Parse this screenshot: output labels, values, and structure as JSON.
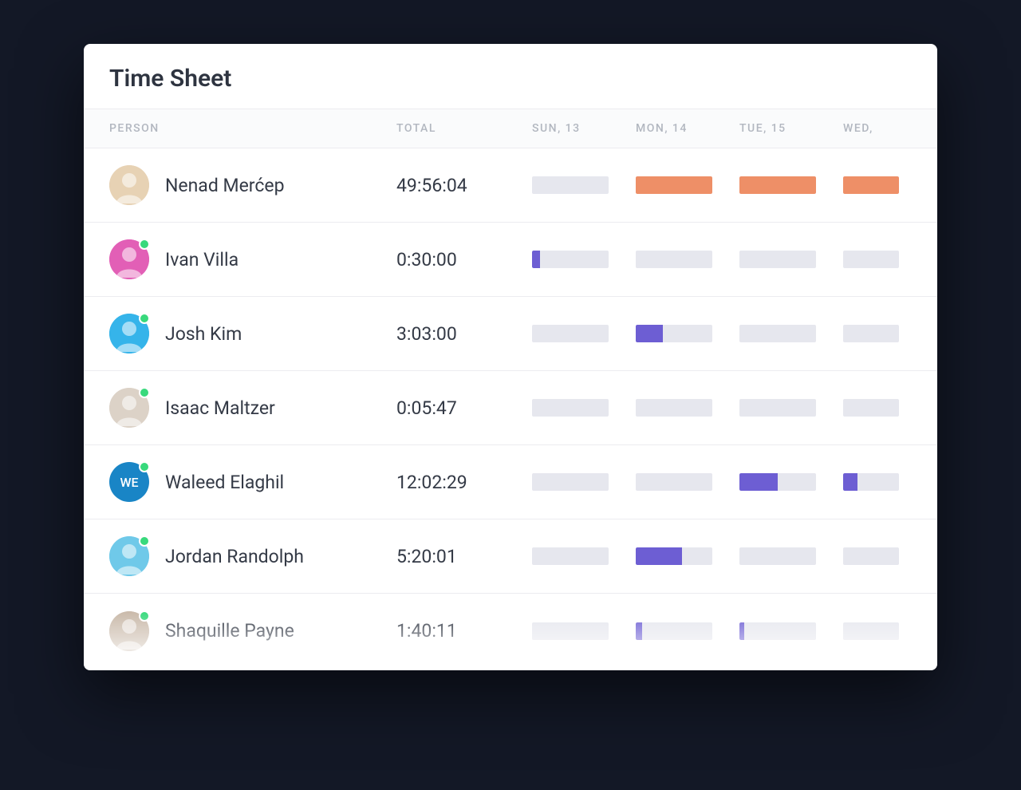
{
  "title": "Time Sheet",
  "columns": {
    "person": "PERSON",
    "total": "TOTAL",
    "days": [
      "SUN, 13",
      "MON, 14",
      "TUE, 15",
      "WED,"
    ]
  },
  "colors": {
    "orange": "#ee8f67",
    "purple": "#6d5ed3",
    "track": "#e6e7ee"
  },
  "people": [
    {
      "name": "Nenad Merćep",
      "total": "49:56:04",
      "online": false,
      "avatar": {
        "type": "photo",
        "bg": "#e7d2b4"
      },
      "bars": [
        {
          "pct": 0,
          "color": "orange"
        },
        {
          "pct": 100,
          "color": "orange"
        },
        {
          "pct": 100,
          "color": "orange"
        },
        {
          "pct": 100,
          "color": "orange"
        }
      ]
    },
    {
      "name": "Ivan Villa",
      "total": "0:30:00",
      "online": true,
      "avatar": {
        "type": "photo",
        "bg": "#e25fb6"
      },
      "bars": [
        {
          "pct": 10,
          "color": "purple"
        },
        {
          "pct": 0,
          "color": "purple"
        },
        {
          "pct": 0,
          "color": "purple"
        },
        {
          "pct": 0,
          "color": "purple"
        }
      ]
    },
    {
      "name": "Josh Kim",
      "total": "3:03:00",
      "online": true,
      "avatar": {
        "type": "photo",
        "bg": "#35b4ea"
      },
      "bars": [
        {
          "pct": 0,
          "color": "purple"
        },
        {
          "pct": 35,
          "color": "purple"
        },
        {
          "pct": 0,
          "color": "purple"
        },
        {
          "pct": 0,
          "color": "purple"
        }
      ]
    },
    {
      "name": "Isaac Maltzer",
      "total": "0:05:47",
      "online": true,
      "avatar": {
        "type": "photo",
        "bg": "#dcd2c7"
      },
      "bars": [
        {
          "pct": 0,
          "color": "purple"
        },
        {
          "pct": 0,
          "color": "purple"
        },
        {
          "pct": 0,
          "color": "purple"
        },
        {
          "pct": 0,
          "color": "purple"
        }
      ]
    },
    {
      "name": "Waleed Elaghil",
      "total": "12:02:29",
      "online": true,
      "avatar": {
        "type": "initials",
        "initials": "WE",
        "bg": "#1985c6"
      },
      "bars": [
        {
          "pct": 0,
          "color": "purple"
        },
        {
          "pct": 0,
          "color": "purple"
        },
        {
          "pct": 50,
          "color": "purple"
        },
        {
          "pct": 25,
          "color": "purple"
        }
      ]
    },
    {
      "name": "Jordan Randolph",
      "total": "5:20:01",
      "online": true,
      "avatar": {
        "type": "photo",
        "bg": "#6fc9e9"
      },
      "bars": [
        {
          "pct": 0,
          "color": "purple"
        },
        {
          "pct": 60,
          "color": "purple"
        },
        {
          "pct": 0,
          "color": "purple"
        },
        {
          "pct": 0,
          "color": "purple"
        }
      ]
    },
    {
      "name": "Shaquille Payne",
      "total": "1:40:11",
      "online": true,
      "avatar": {
        "type": "photo",
        "bg": "#c9b9a9"
      },
      "bars": [
        {
          "pct": 0,
          "color": "purple"
        },
        {
          "pct": 8,
          "color": "purple"
        },
        {
          "pct": 6,
          "color": "purple"
        },
        {
          "pct": 0,
          "color": "purple"
        }
      ]
    }
  ]
}
